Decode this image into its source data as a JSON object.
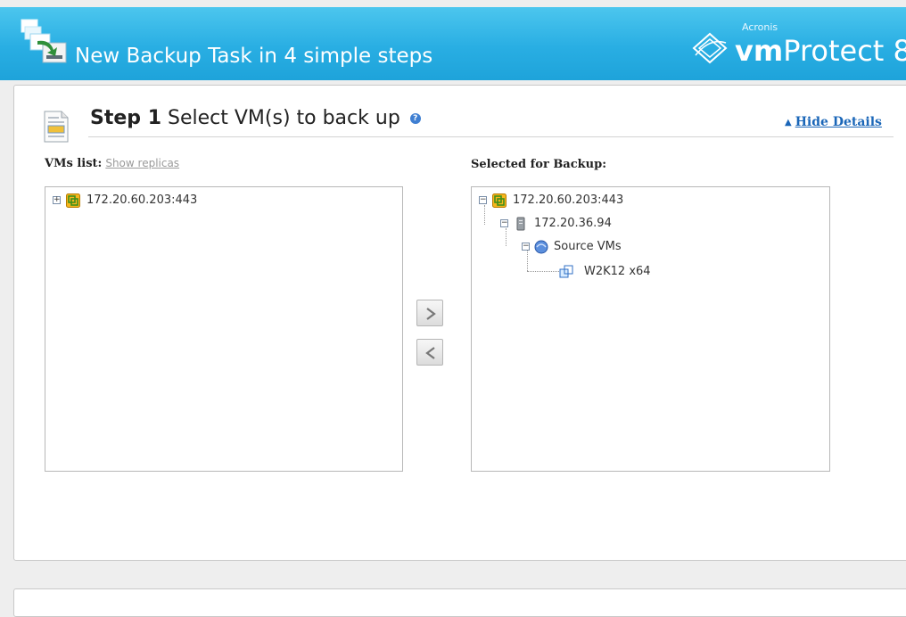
{
  "header": {
    "title": "New Backup Task in 4 simple steps",
    "logo_vendor": "Acronis",
    "logo_product_bold": "vm",
    "logo_product_rest": "Protect 8",
    "icon": "backup-task-icon"
  },
  "step": {
    "number": "Step 1",
    "title": "Select VM(s) to back up",
    "help_icon": "help-icon",
    "hide_details": "Hide Details"
  },
  "vms_list": {
    "label": "VMs list:",
    "show_replicas": "Show replicas",
    "nodes": [
      {
        "label": "172.20.60.203:443",
        "expanded": false,
        "icon": "vcenter-icon"
      }
    ]
  },
  "selected": {
    "label": "Selected for Backup:",
    "nodes": [
      {
        "label": "172.20.60.203:443",
        "icon": "vcenter-icon",
        "expanded": true
      },
      {
        "label": "172.20.36.94",
        "icon": "esx-host-icon",
        "expanded": true
      },
      {
        "label": "Source VMs",
        "icon": "resource-pool-icon",
        "expanded": true
      },
      {
        "label": "W2K12 x64",
        "icon": "vm-icon"
      }
    ]
  },
  "buttons": {
    "add": "add-arrow-button",
    "remove": "remove-arrow-button"
  },
  "colors": {
    "header_blue": "#29aee3",
    "link_blue": "#1a66b8"
  }
}
